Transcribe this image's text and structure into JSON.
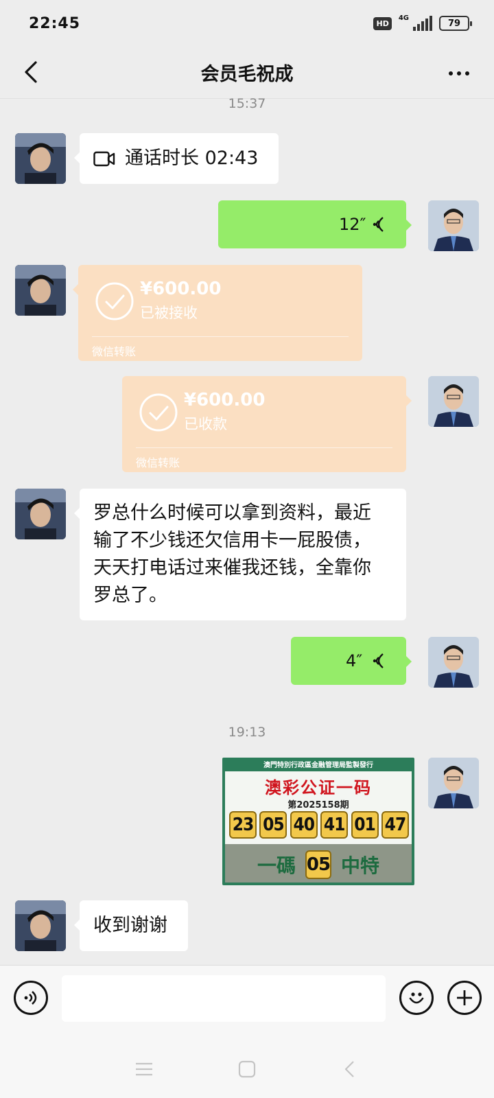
{
  "status_bar": {
    "time": "22:45",
    "hd_label": "HD",
    "network_label": "4G",
    "battery": "79"
  },
  "header": {
    "title": "会员毛祝成",
    "back_icon": "chevron-left-icon",
    "more_icon": "more-dots-icon"
  },
  "timestamps": [
    "15:37",
    "19:13"
  ],
  "messages": [
    {
      "type": "call",
      "side": "left",
      "label": "通话时长 02:43",
      "icon": "video-call-icon"
    },
    {
      "type": "voice",
      "side": "right",
      "duration": "12″"
    },
    {
      "type": "transfer",
      "side": "left",
      "amount": "¥600.00",
      "status": "已被接收",
      "footer": "微信转账"
    },
    {
      "type": "transfer",
      "side": "right",
      "amount": "¥600.00",
      "status": "已收款",
      "footer": "微信转账"
    },
    {
      "type": "text",
      "side": "left",
      "lines": [
        "罗总什么时候可以拿到资料，最近",
        "输了不少钱还欠信用卡一屁股债，",
        "天天打电话过来催我还钱，全靠你",
        "罗总了。"
      ]
    },
    {
      "type": "voice",
      "side": "right",
      "duration": "4″"
    },
    {
      "type": "image",
      "side": "right"
    },
    {
      "type": "text",
      "side": "left",
      "lines": [
        "收到谢谢"
      ]
    }
  ],
  "lottery_image": {
    "top_text": "澳門特別行政區金融管理局監製發行",
    "title": "澳彩公证一码",
    "issue": "第2025158期",
    "numbers": [
      "23",
      "05",
      "40",
      "41",
      "01",
      "47"
    ],
    "bottom_left": "一碼",
    "special": "05",
    "bottom_right": "中特"
  },
  "input_bar": {
    "placeholder": "",
    "voice_icon": "voice-input-icon",
    "emoji_icon": "emoji-icon",
    "plus_icon": "plus-icon"
  },
  "colors": {
    "background": "#ededed",
    "green_bubble": "#95ec69",
    "transfer_bubble": "#fbdfc2"
  }
}
